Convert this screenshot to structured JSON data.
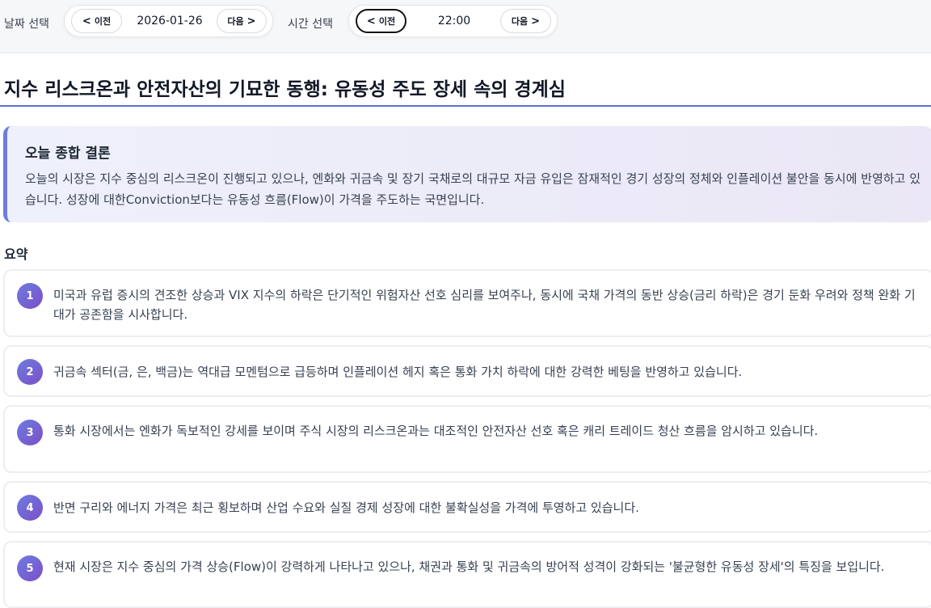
{
  "date_selector": {
    "label": "날짜 선택",
    "prev_label": "이전",
    "value": "2026-01-26",
    "next_label": "다음"
  },
  "time_selector": {
    "label": "시간 선택",
    "prev_label": "이전",
    "value": "22:00",
    "next_label": "다음"
  },
  "headline": "지수 리스크온과 안전자산의 기묘한 동행: 유동성 주도 장세 속의 경계심",
  "conclusion": {
    "title": "오늘 종합 결론",
    "body": "오늘의 시장은 지수 중심의 리스크온이 진행되고 있으나, 엔화와 귀금속 및 장기 국채로의 대규모 자금 유입은 잠재적인 경기 성장의 정체와 인플레이션 불안을 동시에 반영하고 있습니다. 성장에 대한Conviction보다는 유동성 흐름(Flow)이 가격을 주도하는 국면입니다."
  },
  "summary": {
    "title": "요약",
    "items": [
      {
        "num": "1",
        "text": "미국과 유럽 증시의 견조한 상승과 VIX 지수의 하락은 단기적인 위험자산 선호 심리를 보여주나, 동시에 국채 가격의 동반 상승(금리 하락)은 경기 둔화 우려와 정책 완화 기대가 공존함을 시사합니다."
      },
      {
        "num": "2",
        "text": "귀금속 섹터(금, 은, 백금)는 역대급 모멘텀으로 급등하며 인플레이션 헤지 혹은 통화 가치 하락에 대한 강력한 베팅을 반영하고 있습니다."
      },
      {
        "num": "3",
        "text": "통화 시장에서는 엔화가 독보적인 강세를 보이며 주식 시장의 리스크온과는 대조적인 안전자산 선호 혹은 캐리 트레이드 청산 흐름을 암시하고 있습니다."
      },
      {
        "num": "4",
        "text": "반면 구리와 에너지 가격은 최근 횡보하며 산업 수요와 실질 경제 성장에 대한 불확실성을 가격에 투영하고 있습니다."
      },
      {
        "num": "5",
        "text": "현재 시장은 지수 중심의 가격 상승(Flow)이 강력하게 나타나고 있으나, 채권과 통화 및 귀금속의 방어적 성격이 강화되는 '불균형한 유동성 장세'의 특징을 보입니다."
      }
    ]
  },
  "colors": {
    "accent": "#5b6fd6",
    "badge_start": "#6d7ce0",
    "badge_end": "#7b4fc9",
    "conclusion_bg": "#eef0fb"
  }
}
